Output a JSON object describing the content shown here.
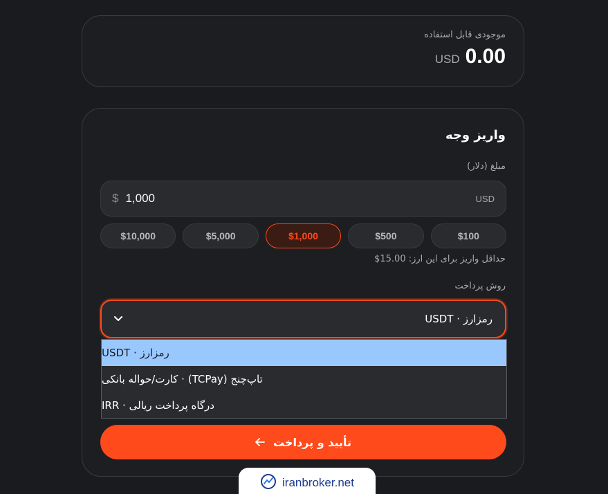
{
  "balance": {
    "label": "موجودی قابل استفاده",
    "amount": "0.00",
    "currency": "USD"
  },
  "deposit": {
    "title": "واریز وجه",
    "amount_label": "مبلغ (دلار)",
    "amount_prefix": "$",
    "amount_value": "1,000",
    "amount_unit": "USD",
    "presets": [
      "$100",
      "$500",
      "$1,000",
      "$5,000",
      "$10,000"
    ],
    "selected_preset": "$1,000",
    "min_note": "حداقل واریز برای این ارز: 15.00$",
    "method_label": "روش پرداخت",
    "method_selected": "رمزارز · USDT",
    "method_options": [
      "رمزارز · USDT",
      "تاپ‌چنج (TCPay) · کارت/حواله بانکی",
      "درگاه پرداخت ریالی · IRR"
    ],
    "submit_label": "تأیید و پرداخت"
  },
  "brand": {
    "text": "iranbroker.net"
  },
  "colors": {
    "accent": "#ff4a1c",
    "background": "#1a1b1e",
    "card": "#1d1e21",
    "highlight": "#99c8ff"
  },
  "icons": {
    "chevron": "chevron-down-icon",
    "arrow": "arrow-left-icon",
    "brand": "chart-logo-icon"
  }
}
